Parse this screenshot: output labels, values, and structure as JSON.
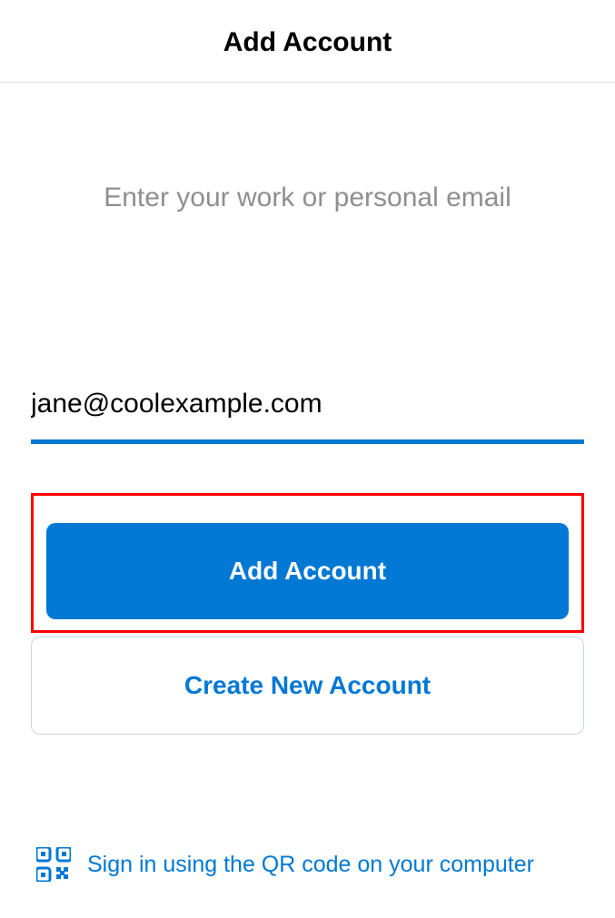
{
  "header": {
    "title": "Add Account"
  },
  "prompt": "Enter your work or personal email",
  "email": {
    "value": "jane@coolexample.com"
  },
  "buttons": {
    "add_account": "Add Account",
    "create_new": "Create New Account"
  },
  "qr": {
    "link_text": "Sign in using the QR code on your computer"
  },
  "colors": {
    "primary": "#0078d4",
    "highlight": "#ff0000"
  }
}
